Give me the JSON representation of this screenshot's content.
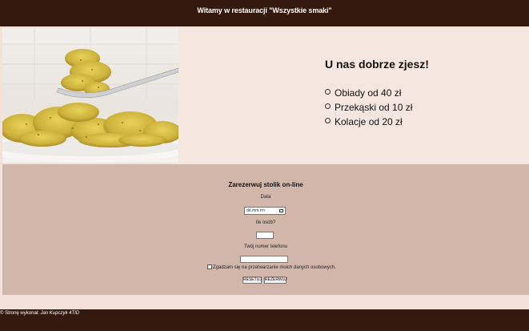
{
  "header": {
    "title": "Witamy w restauracji \"Wszystkie smaki\""
  },
  "photo": {
    "subject": "pasta-on-fork"
  },
  "offer": {
    "heading": "U nas dobrze zjesz!",
    "items": [
      {
        "label": "Obiady od 40 zł"
      },
      {
        "label": "Przekąski od 10 zł"
      },
      {
        "label": "Kolacje od 20 zł"
      }
    ]
  },
  "reservation": {
    "title": "Zarezerwuj stolik on-line",
    "date_label": "Data",
    "date_placeholder": "dd.mm.rrrr",
    "count_label": "Ile osób?",
    "phone_label": "Twój numer telefonu",
    "consent_label": "Zgadzam się na przetwarzanie moich danych osobowych.",
    "reset_label": "RESETUJ",
    "reserve_label": "REZERWUJ"
  },
  "footer": {
    "prefix": "© Stronę wykonał:",
    "author": "Jan Kupczyk 4TID"
  },
  "colors": {
    "banner": "#34190f",
    "offer_bg": "#f6e6e0",
    "form_bg": "#d1b6a9"
  }
}
